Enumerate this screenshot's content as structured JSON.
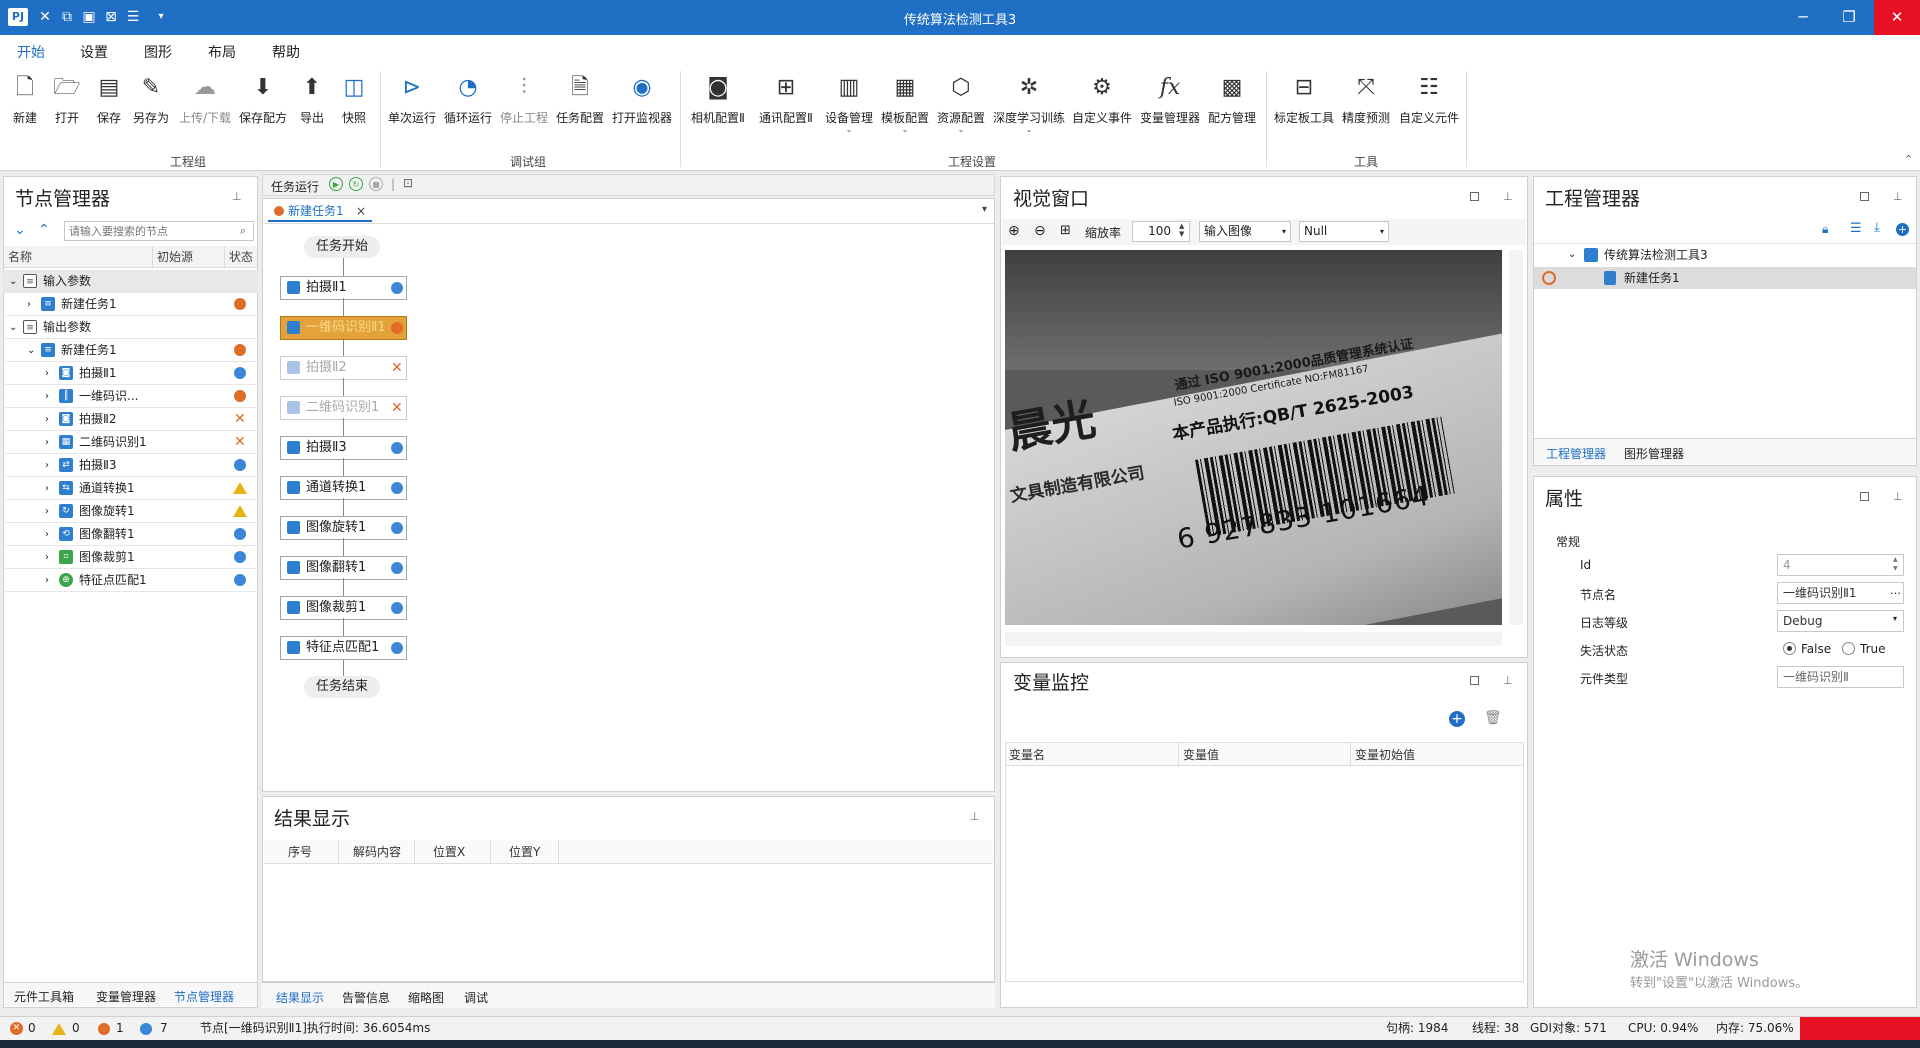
{
  "window": {
    "title": "传统算法检测工具3",
    "app_icon_text": "PJ"
  },
  "menu": [
    "开始",
    "设置",
    "图形",
    "布局",
    "帮助"
  ],
  "ribbon": {
    "groups": [
      {
        "label": "工程组",
        "buttons": [
          {
            "label": "新建",
            "icon": "new-file-icon"
          },
          {
            "label": "打开",
            "icon": "open-folder-icon"
          },
          {
            "label": "保存",
            "icon": "save-icon"
          },
          {
            "label": "另存为",
            "icon": "save-as-icon"
          },
          {
            "label": "上传/下载",
            "icon": "cloud-upload-icon"
          },
          {
            "label": "保存配方",
            "icon": "save-recipe-icon"
          },
          {
            "label": "导出",
            "icon": "export-icon"
          },
          {
            "label": "快照",
            "icon": "snapshot-icon"
          }
        ]
      },
      {
        "label": "调试组",
        "buttons": [
          {
            "label": "单次运行",
            "icon": "play-once-icon"
          },
          {
            "label": "循环运行",
            "icon": "loop-run-icon"
          },
          {
            "label": "停止工程",
            "icon": "stop-icon"
          },
          {
            "label": "任务配置",
            "icon": "task-config-icon"
          },
          {
            "label": "打开监视器",
            "icon": "monitor-icon"
          }
        ]
      },
      {
        "label": "工程设置",
        "buttons": [
          {
            "label": "相机配置Ⅱ",
            "icon": "camera-icon"
          },
          {
            "label": "通讯配置Ⅱ",
            "icon": "network-icon"
          },
          {
            "label": "设备管理",
            "icon": "device-icon",
            "dropdown": true
          },
          {
            "label": "模板配置",
            "icon": "template-icon",
            "dropdown": true
          },
          {
            "label": "资源配置",
            "icon": "resource-icon",
            "dropdown": true
          },
          {
            "label": "深度学习训练",
            "icon": "deep-learning-icon",
            "dropdown": true
          },
          {
            "label": "自定义事件",
            "icon": "gear-event-icon"
          },
          {
            "label": "变量管理器",
            "icon": "fx-icon"
          },
          {
            "label": "配方管理",
            "icon": "recipe-icon"
          }
        ]
      },
      {
        "label": "工具",
        "buttons": [
          {
            "label": "标定板工具",
            "icon": "calibration-icon"
          },
          {
            "label": "精度预测",
            "icon": "precision-icon"
          },
          {
            "label": "自定义元件",
            "icon": "custom-element-icon"
          }
        ]
      }
    ]
  },
  "node_manager": {
    "title": "节点管理器",
    "search_placeholder": "请输入要搜索的节点",
    "columns": [
      "名称",
      "初始源",
      "状态"
    ],
    "groups": [
      {
        "label": "输入参数",
        "children": [
          {
            "label": "新建任务1",
            "status": "orange"
          }
        ]
      },
      {
        "label": "输出参数",
        "children": [
          {
            "label": "新建任务1",
            "status": "orange",
            "children": [
              {
                "label": "拍摄Ⅱ1",
                "status": "blue"
              },
              {
                "label": "一维码识...",
                "status": "orange"
              },
              {
                "label": "拍摄Ⅱ2",
                "status": "x"
              },
              {
                "label": "二维码识别1",
                "status": "x"
              },
              {
                "label": "拍摄Ⅱ3",
                "status": "blue"
              },
              {
                "label": "通道转换1",
                "status": "warn"
              },
              {
                "label": "图像旋转1",
                "status": "warn"
              },
              {
                "label": "图像翻转1",
                "status": "blue"
              },
              {
                "label": "图像裁剪1",
                "status": "blue"
              },
              {
                "label": "特征点匹配1",
                "status": "blue"
              }
            ]
          }
        ]
      }
    ],
    "bottom_tabs": [
      "元件工具箱",
      "变量管理器",
      "节点管理器"
    ]
  },
  "task_panel": {
    "toolbar_label": "任务运行",
    "tab_label": "新建任务1",
    "start_label": "任务开始",
    "end_label": "任务结束",
    "nodes": [
      {
        "label": "拍摄Ⅱ1",
        "status": "blue"
      },
      {
        "label": "一维码识别Ⅱ1",
        "status": "orange",
        "selected": true
      },
      {
        "label": "拍摄Ⅱ2",
        "status": "x",
        "disabled": true
      },
      {
        "label": "二维码识别1",
        "status": "x",
        "disabled": true
      },
      {
        "label": "拍摄Ⅱ3",
        "status": "blue"
      },
      {
        "label": "通道转换1",
        "status": "blue"
      },
      {
        "label": "图像旋转1",
        "status": "blue"
      },
      {
        "label": "图像翻转1",
        "status": "blue"
      },
      {
        "label": "图像裁剪1",
        "status": "blue"
      },
      {
        "label": "特征点匹配1",
        "status": "blue"
      }
    ]
  },
  "results": {
    "title": "结果显示",
    "columns": [
      "序号",
      "解码内容",
      "位置X",
      "位置Y"
    ],
    "bottom_tabs": [
      "结果显示",
      "告警信息",
      "缩略图",
      "调试"
    ]
  },
  "vision": {
    "title": "视觉窗口",
    "zoom_label": "缩放率",
    "zoom_value": "100",
    "image_select": "输入图像",
    "null_select": "Null",
    "label_lines": [
      "通过 ISO 9001:2000品质管理系统认证",
      "ISO 9001:2000  Certificate NO:FM81167",
      "本产品执行:QB/T 2625-2003"
    ],
    "brand_text": "晨光",
    "company_text": "文具制造有限公司",
    "barcode_number": "6 927833 101664"
  },
  "variables": {
    "title": "变量监控",
    "columns": [
      "变量名",
      "变量值",
      "变量初始值"
    ]
  },
  "project": {
    "title": "工程管理器",
    "tree": [
      {
        "label": "传统算法检测工具3"
      },
      {
        "label": "新建任务1"
      }
    ],
    "tabs": [
      "工程管理器",
      "图形管理器"
    ]
  },
  "properties": {
    "title": "属性",
    "section": "常规",
    "rows": [
      {
        "label": "Id",
        "value": "4"
      },
      {
        "label": "节点名",
        "value": "一维码识别Ⅱ1"
      },
      {
        "label": "日志等级",
        "value": "Debug"
      },
      {
        "label": "失活状态",
        "value": ""
      },
      {
        "label": "元件类型",
        "value": "一维码识别Ⅱ"
      }
    ],
    "radio_false": "False",
    "radio_true": "True"
  },
  "watermark": {
    "line1": "激活 Windows",
    "line2": "转到\"设置\"以激活 Windows。"
  },
  "statusbar": {
    "errors": "0",
    "warnings": "0",
    "orange_count": "1",
    "blue_count": "7",
    "message": "节点[一维码识别Ⅱ1]执行时间: 36.6054ms",
    "handles": "句柄: 1984",
    "threads": "线程: 38",
    "gdi": "GDI对象: 571",
    "cpu": "CPU: 0.94%",
    "memory": "内存: 75.06%"
  },
  "colors": {
    "accent": "#1f6fc5",
    "status_blue": "#3a87d8",
    "status_orange": "#e06c2a",
    "selected_node": "#e4a23a",
    "close_red": "#e81123"
  }
}
